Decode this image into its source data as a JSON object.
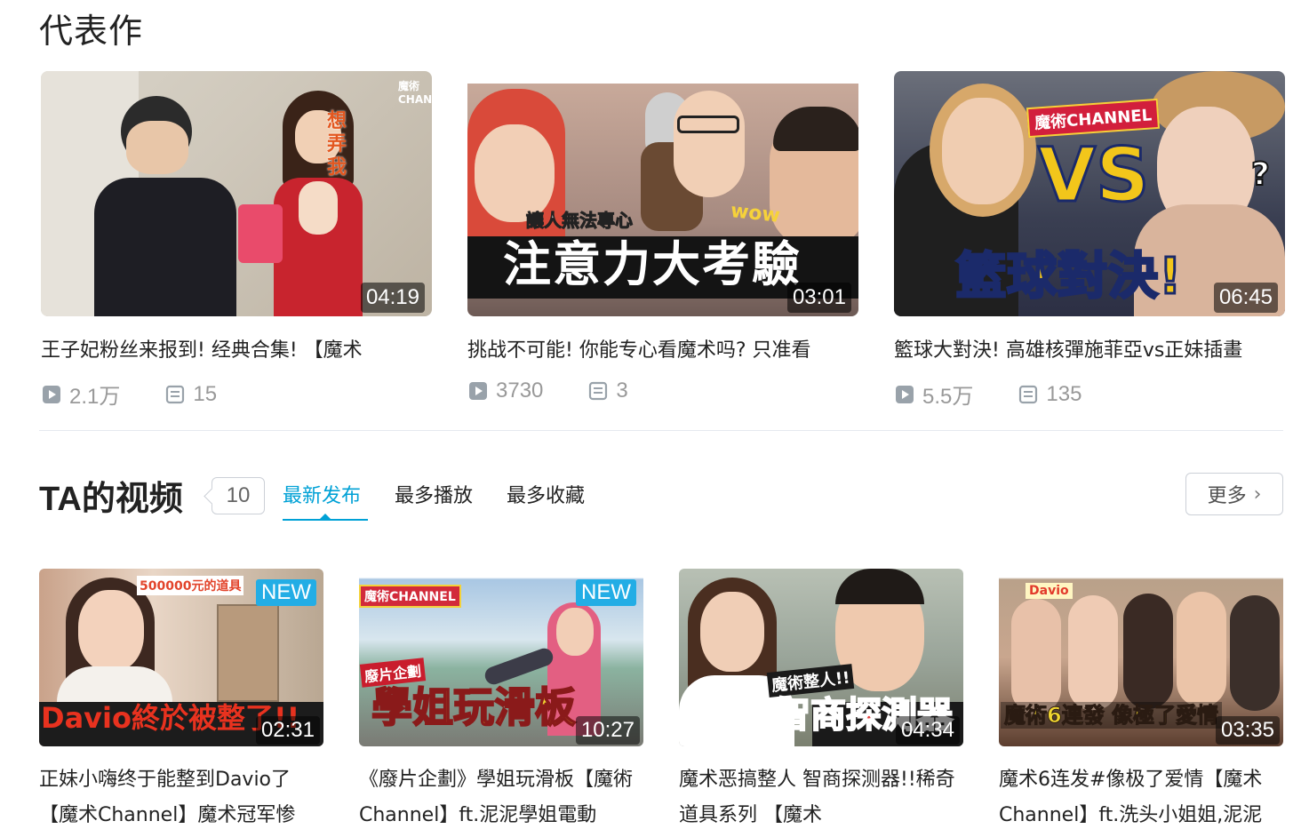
{
  "featured": {
    "title": "代表作",
    "items": [
      {
        "title": "王子妃粉丝来报到! 经典合集! 【魔术",
        "duration": "04:19",
        "views": "2.1万",
        "comments": "15",
        "overlay": "想弄我",
        "logo": "魔術CHANNEL"
      },
      {
        "title": "挑战不可能! 你能专心看魔术吗? 只准看",
        "duration": "03:01",
        "views": "3730",
        "comments": "3",
        "overlay_top": "讓人無法專心",
        "overlay_wow": "wow",
        "overlay_main": "注意力大考驗"
      },
      {
        "title": "籃球大對決! 高雄核彈施菲亞vs正妹插畫",
        "duration": "06:45",
        "views": "5.5万",
        "comments": "135",
        "logo": "魔術CHANNEL",
        "overlay_vs": "VS",
        "overlay_main": "籃球對決!",
        "overlay_q": "?"
      }
    ]
  },
  "videos": {
    "title": "TA的视频",
    "count": "10",
    "tabs": [
      {
        "label": "最新发布",
        "active": true
      },
      {
        "label": "最多播放",
        "active": false
      },
      {
        "label": "最多收藏",
        "active": false
      }
    ],
    "more_label": "更多",
    "items": [
      {
        "title": "正妹小嗨终于能整到Davio了【魔术Channel】魔术冠军惨",
        "duration": "02:31",
        "badge": "NEW",
        "overlay_top": "500000元的道具",
        "overlay_main": "Davio終於被整了!!"
      },
      {
        "title": "《廢片企劃》學姐玩滑板【魔術Channel】ft.泥泥學姐電動",
        "duration": "10:27",
        "badge": "NEW",
        "logo": "魔術CHANNEL",
        "overlay_top": "廢片企劃",
        "overlay_main": "學姐玩滑板"
      },
      {
        "title": "魔术恶搞整人 智商探测器!!稀奇道具系列 【魔术",
        "duration": "04:34",
        "badge": "",
        "overlay_top": "魔術整人!!",
        "overlay_main": "智商探測器"
      },
      {
        "title": "魔术6连发#像极了爱情【魔术Channel】ft.洗头小姐姐,泥泥",
        "duration": "03:35",
        "badge": "",
        "logo": "Davio",
        "overlay_main": "魔術6連發 像極了愛情"
      }
    ]
  },
  "colors": {
    "accent": "#00a1d6",
    "badge": "#23ade5",
    "muted": "#999999"
  }
}
